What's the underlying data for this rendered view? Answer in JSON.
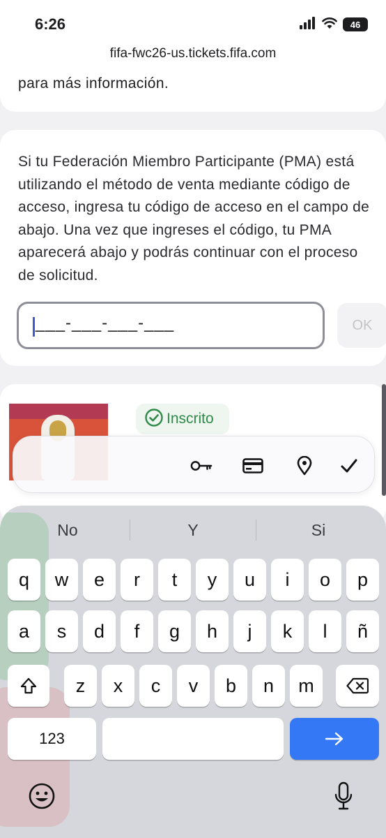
{
  "status_bar": {
    "time": "6:26",
    "battery": "46"
  },
  "browser": {
    "url": "fifa-fwc26-us.tickets.fifa.com"
  },
  "card_top": {
    "text": "para más información."
  },
  "main_card": {
    "paragraph": "Si tu Federación Miembro Participante (PMA) está utilizando el método de venta mediante código de acceso, ingresa tu código de acceso en el campo de abajo. Una vez que ingreses el código, tu PMA aparecerá abajo y podrás continuar con el proceso de solicitud.",
    "code_input": {
      "mask": "___-___-___-___"
    },
    "ok_label": "OK"
  },
  "pma_card": {
    "status_badge": "Inscrito"
  },
  "autofill_bar": {
    "icons": [
      "key-icon",
      "credit-card-icon",
      "location-pin-icon",
      "checkmark-icon"
    ]
  },
  "keyboard": {
    "suggestions": [
      "No",
      "Y",
      "Si"
    ],
    "row1": [
      "q",
      "w",
      "e",
      "r",
      "t",
      "y",
      "u",
      "i",
      "o",
      "p"
    ],
    "row2": [
      "a",
      "s",
      "d",
      "f",
      "g",
      "h",
      "j",
      "k",
      "l",
      "ñ"
    ],
    "row3": [
      "z",
      "x",
      "c",
      "v",
      "b",
      "n",
      "m"
    ],
    "numbers_label": "123",
    "enter_icon": "arrow-right-icon"
  },
  "colors": {
    "accent": "#3478f6",
    "success": "#2f8a4a",
    "input_border": "#8e8e98"
  }
}
